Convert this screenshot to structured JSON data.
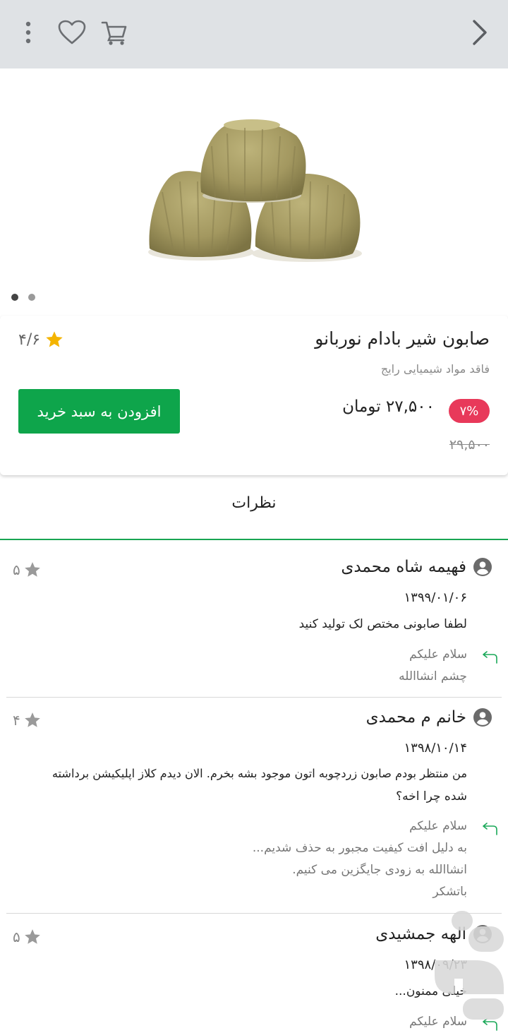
{
  "product": {
    "title": "صابون شیر بادام نوربانو",
    "subtitle": "فاقد مواد شیمیایی رایج",
    "rating": "۴/۶",
    "price": "۲۷,۵۰۰  تومان",
    "discount": "۷%",
    "old_price": "۲۹,۵۰۰",
    "add_to_cart_label": "افزودن به سبد خرید",
    "image_count": 2,
    "active_image": 1
  },
  "reviews_title": "نظرات",
  "reviews": [
    {
      "name": "فهیمه شاه محمدی",
      "rating": "۵",
      "date": "۱۳۹۹/۰۱/۰۶",
      "text": "لطفا صابونی مختص لک تولید کنید",
      "reply_lines": [
        "سلام علیکم",
        "چشم انشاالله"
      ]
    },
    {
      "name": "خانم م محمدی",
      "rating": "۴",
      "date": "۱۳۹۸/۱۰/۱۴",
      "text_lines": [
        "من منتظر بودم صابون زردچوبه اتون موجود بشه بخرم. الان دیدم کلاز اپلیکیشن برداشته",
        "شده چرا اخه؟"
      ],
      "reply_lines": [
        "سلام علیکم",
        "به دلیل افت کیفیت مجبور به حذف شدیم...",
        "انشاالله به زودی جایگزین می کنیم.",
        "باتشکر"
      ]
    },
    {
      "name": "الهه جمشیدی",
      "rating": "۵",
      "date": "۱۳۹۸/۰۹/۲۳",
      "text": "خیلی ممنون...",
      "reply_lines": [
        "سلام علیکم"
      ]
    }
  ],
  "colors": {
    "topbar": "#dfe2e5",
    "accent_green": "#0ea54b",
    "discount_red": "#e8395a",
    "star_gold": "#f4b400",
    "star_gray": "#9a9a9a"
  },
  "icons": {
    "back": "chevron-right-icon",
    "cart": "cart-icon",
    "favorite": "heart-icon",
    "menu": "more-vertical-icon",
    "reply": "reply-icon",
    "user": "user-circle-icon"
  }
}
